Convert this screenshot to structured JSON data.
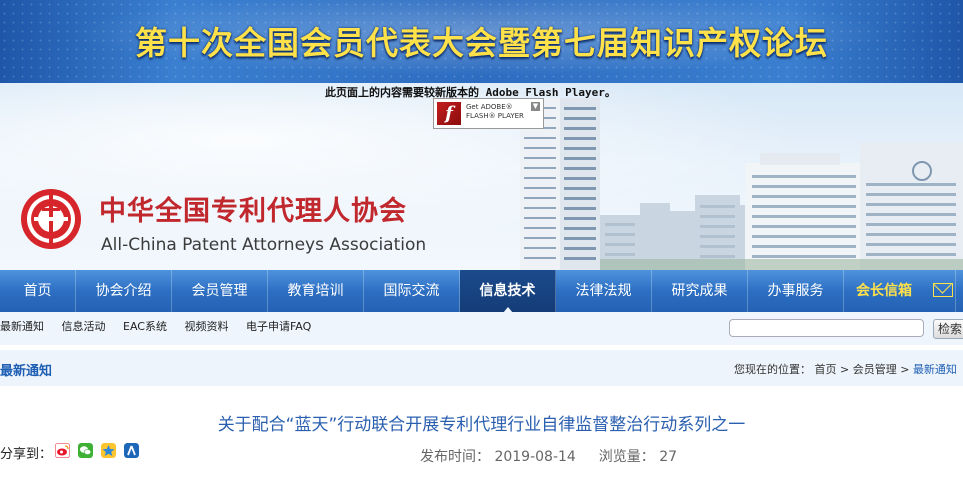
{
  "banner": {
    "title": "第十次全国会员代表大会暨第七届知识产权论坛"
  },
  "flash": {
    "notice": "此页面上的内容需要较新版本的 Adobe Flash Player。",
    "badge_line1": "Get ADOBE®",
    "badge_line2": "FLASH® PLAYER"
  },
  "header": {
    "name_cn": "中华全国专利代理人协会",
    "name_en": "All-China Patent Attorneys Association"
  },
  "nav": {
    "items": [
      {
        "label": "首页"
      },
      {
        "label": "协会介绍"
      },
      {
        "label": "会员管理"
      },
      {
        "label": "教育培训"
      },
      {
        "label": "国际交流"
      },
      {
        "label": "信息技术"
      },
      {
        "label": "法律法规"
      },
      {
        "label": "研究成果"
      },
      {
        "label": "办事服务"
      },
      {
        "label": "会长信箱"
      }
    ],
    "active": "信息技术"
  },
  "subnav": {
    "links": [
      {
        "label": "最新通知"
      },
      {
        "label": "信息活动"
      },
      {
        "label": "EAC系统"
      },
      {
        "label": "视频资料"
      },
      {
        "label": "电子申请FAQ"
      }
    ],
    "search_value": "",
    "search_button": "检索"
  },
  "section": {
    "title": "最新通知",
    "location_prefix": "您现在的位置：",
    "crumbs": [
      "首页",
      ">",
      "会员管理",
      ">",
      "最新通知"
    ]
  },
  "article": {
    "title": "关于配合“蓝天”行动联合开展专利代理行业自律监督整治行动系列之一",
    "share_label": "分享到：",
    "publish_label": "发布时间：",
    "publish_date": "2019-08-14",
    "views_label": "浏览量：",
    "views": "27"
  },
  "colors": {
    "banner_text": "#ffe14a",
    "nav_blue": "#2d6fc2",
    "nav_active": "#143d77",
    "brand_red": "#c0282d",
    "link_blue": "#1e5fb4"
  },
  "icons": [
    "flash-player-icon",
    "association-logo",
    "mail-icon",
    "sina-weibo-icon",
    "wechat-icon",
    "qzone-icon",
    "renren-icon"
  ]
}
